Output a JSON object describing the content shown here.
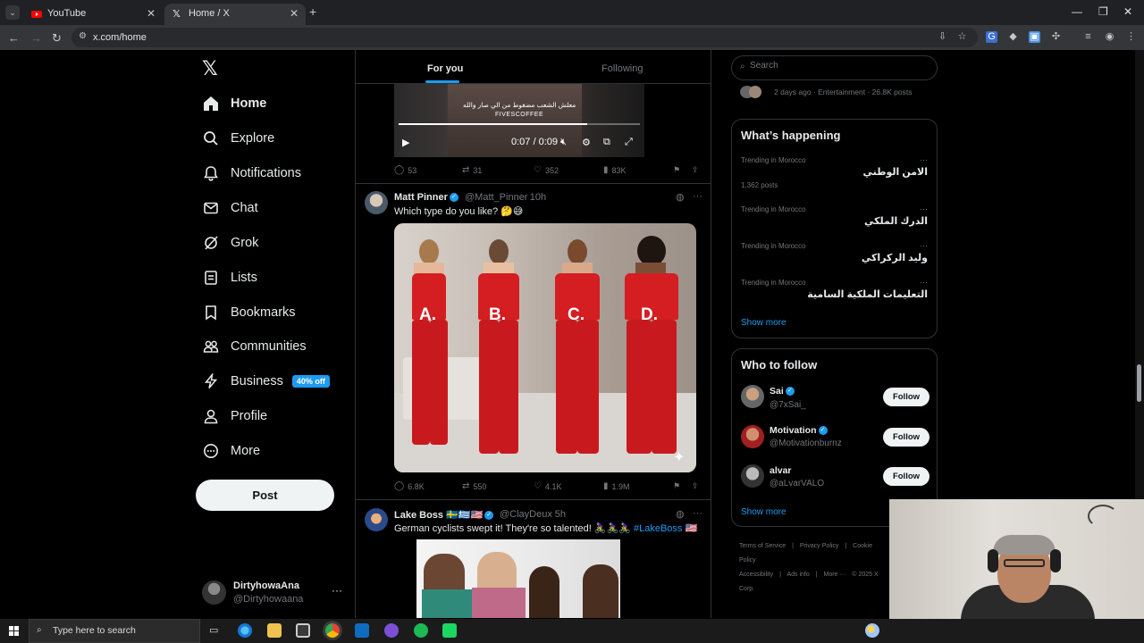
{
  "browser": {
    "tabs": [
      {
        "title": "YouTube",
        "active": false
      },
      {
        "title": "Home / X",
        "active": true
      }
    ],
    "url": "x.com/home"
  },
  "nav": {
    "items": [
      {
        "label": "Home",
        "icon": "home-icon",
        "selected": true
      },
      {
        "label": "Explore",
        "icon": "search-icon"
      },
      {
        "label": "Notifications",
        "icon": "bell-icon"
      },
      {
        "label": "Chat",
        "icon": "mail-icon"
      },
      {
        "label": "Grok",
        "icon": "grok-icon"
      },
      {
        "label": "Lists",
        "icon": "list-icon"
      },
      {
        "label": "Bookmarks",
        "icon": "bookmark-icon"
      },
      {
        "label": "Communities",
        "icon": "people-icon"
      },
      {
        "label": "Business",
        "icon": "lightning-icon",
        "badge": "40% off"
      },
      {
        "label": "Profile",
        "icon": "person-icon"
      },
      {
        "label": "More",
        "icon": "more-circle-icon"
      }
    ],
    "post_label": "Post",
    "account": {
      "name": "DirtyhowaAna",
      "handle": "@Dirtyhowaana"
    }
  },
  "feed": {
    "tabs": {
      "for_you": "For you",
      "following": "Following"
    },
    "video_post": {
      "caption_ar": "معلش الشعب مضغوط من الي صار والله",
      "caption_brand": "FIVESCOFFEE",
      "time": "0:07 / 0:09",
      "progress": 0.78,
      "stats": {
        "replies": "53",
        "reposts": "31",
        "likes": "352",
        "views": "83K"
      }
    },
    "post1": {
      "name": "Matt Pinner",
      "handle": "@Matt_Pinner",
      "time": "· 10h",
      "text": "Which type do you like? 🤔😅",
      "labels": [
        "A.",
        "B.",
        "C.",
        "D."
      ],
      "stats": {
        "replies": "6.8K",
        "reposts": "550",
        "likes": "4.1K",
        "views": "1.9M"
      }
    },
    "post2": {
      "name": "Lake Boss 🇸🇪🇬🇷🇺🇸",
      "handle": "@ClayDeux",
      "time": "· 5h",
      "text": "German cyclists swept it! They're so talented! 🚴‍♀️🚴‍♀️🚴‍♀️ ",
      "hashtag": "#LakeBoss 🇺🇸"
    }
  },
  "sidebar": {
    "search_placeholder": "Search",
    "top_meta": "2 days ago · Entertainment · 26.8K posts",
    "whats_happening": {
      "title": "What’s happening",
      "trends": [
        {
          "meta": "Trending in Morocco",
          "name": "الامن الوطني",
          "count": "1,362 posts"
        },
        {
          "meta": "Trending in Morocco",
          "name": "الدرك الملكي",
          "count": ""
        },
        {
          "meta": "Trending in Morocco",
          "name": "وليد الركراكي",
          "count": ""
        },
        {
          "meta": "Trending in Morocco",
          "name": "التعليمات الملكية السامية",
          "count": ""
        }
      ],
      "show_more": "Show more"
    },
    "who_to_follow": {
      "title": "Who to follow",
      "accounts": [
        {
          "name": "Sai",
          "handle": "@7xSai_",
          "button": "Follow"
        },
        {
          "name": "Motivation",
          "handle": "@Motivationburnz",
          "button": "Follow"
        },
        {
          "name": "alvar",
          "handle": "@aLvarVALO",
          "button": "Follow"
        }
      ],
      "show_more": "Show more"
    },
    "footer": {
      "links": [
        "Terms of Service",
        "|",
        "Privacy Policy",
        "|",
        "Cookie Policy",
        "Accessibility",
        "|",
        "Ads info",
        "|",
        "More ···",
        "© 2025 X Corp."
      ]
    }
  },
  "taskbar": {
    "search_placeholder": "Type here to search"
  },
  "colors": {
    "accent": "#1d9bf0",
    "background": "#000000",
    "border": "#2f3336",
    "muted": "#71767b"
  }
}
